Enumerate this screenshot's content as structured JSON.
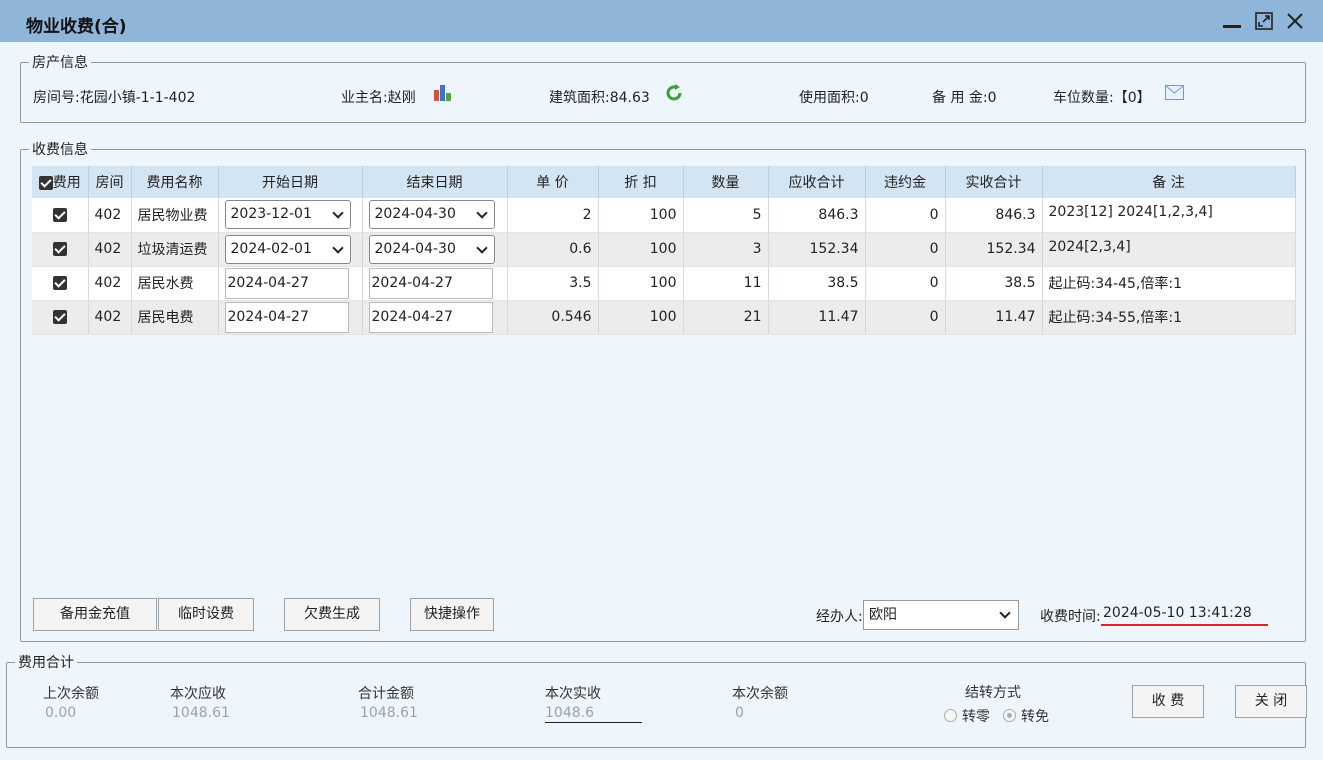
{
  "window": {
    "title": "物业收费(合)"
  },
  "property": {
    "legend": "房产信息",
    "room_no": "房间号:花园小镇-1-1-402",
    "owner": "业主名:赵刚",
    "building_area": "建筑面积:84.63",
    "usable_area": "使用面积:0",
    "reserve": "备 用 金:0",
    "parking": "车位数量:【0】"
  },
  "fees": {
    "legend": "收费信息",
    "columns": [
      "费用",
      "房间",
      "费用名称",
      "开始日期",
      "结束日期",
      "单 价",
      "折 扣",
      "数量",
      "应收合计",
      "违约金",
      "实收合计",
      "备 注"
    ],
    "rows": [
      {
        "room": "402",
        "name": "居民物业费",
        "start": "2023-12-01",
        "end": "2024-04-30",
        "price": "2",
        "discount": "100",
        "qty": "5",
        "due": "846.3",
        "penalty": "0",
        "paid": "846.3",
        "note": "2023[12] 2024[1,2,3,4]"
      },
      {
        "room": "402",
        "name": "垃圾清运费",
        "start": "2024-02-01",
        "end": "2024-04-30",
        "price": "0.6",
        "discount": "100",
        "qty": "3",
        "due": "152.34",
        "penalty": "0",
        "paid": "152.34",
        "note": "2024[2,3,4]"
      },
      {
        "room": "402",
        "name": "居民水费",
        "start": "2024-04-27",
        "end": "2024-04-27",
        "price": "3.5",
        "discount": "100",
        "qty": "11",
        "due": "38.5",
        "penalty": "0",
        "paid": "38.5",
        "note": "起止码:34-45,倍率:1"
      },
      {
        "room": "402",
        "name": "居民电费",
        "start": "2024-04-27",
        "end": "2024-04-27",
        "price": "0.546",
        "discount": "100",
        "qty": "21",
        "due": "11.47",
        "penalty": "0",
        "paid": "11.47",
        "note": "起止码:34-55,倍率:1"
      }
    ],
    "buttons": {
      "recharge": "备用金充值",
      "temp_fee": "临时设费",
      "arrears": "欠费生成",
      "quick": "快捷操作"
    },
    "operator_label": "经办人:",
    "operator_value": "欧阳",
    "charge_time_label": "收费时间:",
    "charge_time_value": "2024-05-10 13:41:28"
  },
  "summary": {
    "legend": "费用合计",
    "last_balance_label": "上次余额",
    "last_balance": "0.00",
    "current_due_label": "本次应收",
    "current_due": "1048.61",
    "total_label": "合计金额",
    "total": "1048.61",
    "current_paid_label": "本次实收",
    "current_paid": "1048.6",
    "current_balance_label": "本次余额",
    "current_balance": "0",
    "carry_label": "结转方式",
    "carry_zero": "转零",
    "carry_free": "转免",
    "charge_button": "收 费",
    "close_button": "关 闭"
  }
}
